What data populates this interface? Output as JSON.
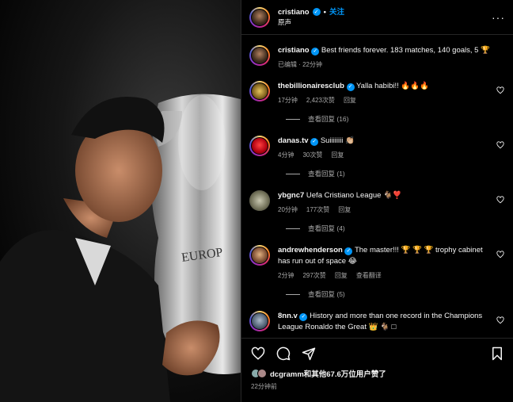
{
  "post": {
    "author": "cristiano",
    "follow_label": "关注",
    "audio": "原声",
    "more_icon": "more-options-icon"
  },
  "caption": {
    "username": "cristiano",
    "text": "Best friends forever. 183 matches, 140 goals, 5 🏆",
    "meta": "已编辑 · 22分钟"
  },
  "comments": [
    {
      "username": "thebillionairesclub",
      "verified": true,
      "text": "Yalla habibi!! 🔥🔥🔥",
      "time": "17分钟",
      "likes": "2,423次赞",
      "reply": "回复",
      "translate": "",
      "view_replies": "查看回复 (16)"
    },
    {
      "username": "danas.tv",
      "verified": true,
      "text": "Suiiiiiiii 👏🏼",
      "time": "4分钟",
      "likes": "30次赞",
      "reply": "回复",
      "translate": "",
      "view_replies": "查看回复 (1)"
    },
    {
      "username": "ybgnc7",
      "verified": false,
      "text": "Uefa Cristiano League 🐐❣️",
      "time": "20分钟",
      "likes": "177次赞",
      "reply": "回复",
      "translate": "",
      "view_replies": "查看回复 (4)"
    },
    {
      "username": "andrewhenderson",
      "verified": true,
      "text": "The master!!! 🏆 🏆 🏆 trophy cabinet has run out of space 😂",
      "time": "2分钟",
      "likes": "297次赞",
      "reply": "回复",
      "translate": "查看翻译",
      "view_replies": "查看回复 (5)"
    },
    {
      "username": "8nn.v",
      "verified": true,
      "text": "History and more than one record in the Champions League Ronaldo the Great 👑 🐐 □",
      "time": "",
      "likes": "",
      "reply": "",
      "translate": "",
      "view_replies": ""
    }
  ],
  "footer": {
    "liked_by": "dcgramm和其他67.6万位用户赞了",
    "time": "22分钟前"
  },
  "colors": {
    "accent": "#0095f6",
    "muted": "#a8a8a8",
    "background": "#000000"
  }
}
